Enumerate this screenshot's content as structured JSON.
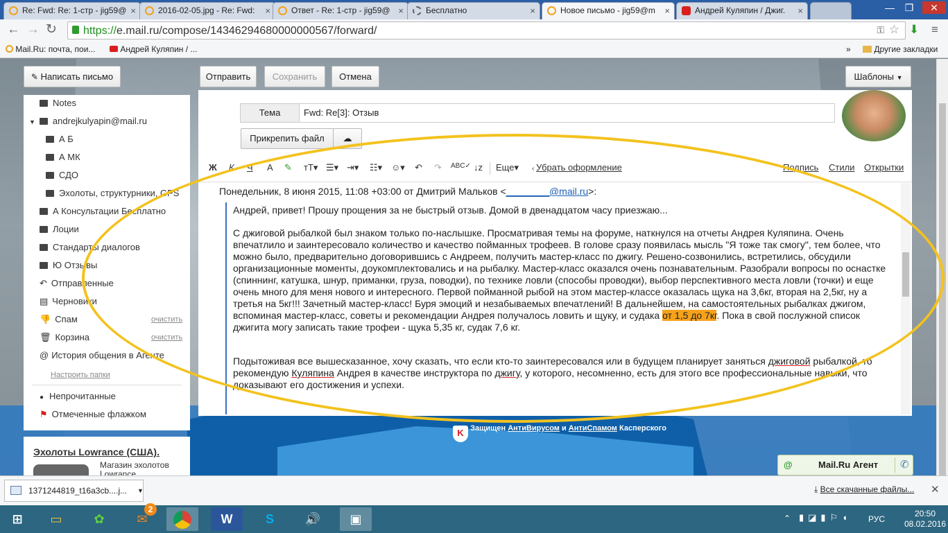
{
  "browser": {
    "tabs": [
      {
        "label": "Re: Fwd: Re: 1-стр - jig59@",
        "icon": "mailru"
      },
      {
        "label": "2016-02-05.jpg - Re: Fwd:",
        "icon": "mailru"
      },
      {
        "label": "Ответ - Re: 1-стр - jig59@",
        "icon": "mailru"
      },
      {
        "label": "Бесплатно",
        "icon": "gear"
      },
      {
        "label": "Новое письмо - jig59@m",
        "icon": "mailru",
        "active": true
      },
      {
        "label": "Андрей Куляпин / Джиг.",
        "icon": "youtube"
      }
    ],
    "url_scheme": "https://",
    "url_rest": "e.mail.ru/compose/14346294680000000567/forward/",
    "bookmarks": [
      "Mail.Ru: почта, пои...",
      "Андрей Куляпин / ..."
    ],
    "other_bookmarks": "Другие закладки"
  },
  "toolbar": {
    "compose": "Написать письмо",
    "send": "Отправить",
    "save": "Сохранить",
    "cancel": "Отмена",
    "templates": "Шаблоны"
  },
  "sidebar": {
    "folders": [
      {
        "label": "Notes",
        "indent": 1
      },
      {
        "label": "andrejkulyapin@mail.ru",
        "indent": 0,
        "expander": true
      },
      {
        "label": "А Б",
        "indent": 2
      },
      {
        "label": "А МК",
        "indent": 2
      },
      {
        "label": "СДО",
        "indent": 2
      },
      {
        "label": "Эхолоты, структурники, GPS",
        "indent": 2
      },
      {
        "label": "А Консультации Бесплатно",
        "indent": 1
      },
      {
        "label": "Лоции",
        "indent": 1
      },
      {
        "label": "Стандарты диалогов",
        "indent": 1
      },
      {
        "label": "Ю Отзывы",
        "indent": 1
      },
      {
        "label": "Отправленные",
        "indent": 1
      },
      {
        "label": "Черновики",
        "indent": 1
      },
      {
        "label": "Спам",
        "indent": 1,
        "action": "очистить"
      },
      {
        "label": "Корзина",
        "indent": 1,
        "action": "очистить"
      },
      {
        "label": "История общения в Агенте",
        "indent": 1
      }
    ],
    "configure": "Настроить папки",
    "unread": "Непрочитанные",
    "flagged": "Отмеченные флажком",
    "ad_title": "Эхолоты Lowrance (США).",
    "ad_text": "Магазин эхолотов Lowrance"
  },
  "compose": {
    "subject_label": "Тема",
    "subject_value": "Fwd: Re[3]: Отзыв",
    "attach": "Прикрепить файл",
    "format": {
      "bold": "Ж",
      "italic": "К",
      "underline": "Ч",
      "more": "Еще",
      "remove_format": "Убрать оформление",
      "signature": "Подпись",
      "styles": "Стили",
      "cards": "Открытки"
    },
    "quote_header_pre": "Понедельник, 8 июня 2015, 11:08 +03:00 от Дмитрий Мальков <",
    "quote_header_link": "________@mail.ru",
    "quote_header_post": ">:",
    "p1": "Андрей, привет! Прошу прощения за не быстрый отзыв. Домой в двенадцатом часу приезжаю...",
    "p2_a": "С джиговой рыбалкой был знаком только по-наслышке. Просматривая темы на форуме, наткнулся на отчеты Андрея Куляпина. Очень впечатлило и заинтересовало количество и качество пойманных трофеев. В голове сразу появилась мысль \"Я тоже так смогу\", тем более, что можно было, предварительно договорившись с Андреем, получить мастер-класс по джигу. Решено-созвонились, встретились, обсудили организационные моменты, доукомплектовались и на рыбалку. Мастер-класс оказался очень познавательным. Разобрали вопросы по оснастке (спиннинг, катушка, шнур, приманки, груза, поводки), по технике ловли (способы проводки), выбор перспективного места ловли (точки) и еще очень много для меня нового и интересного. Первой пойманной рыбой на этом мастер-классе оказалась щука на 3,6кг, вторая на 2,5кг, ну а третья на 5кг!!! Зачетный мастер-класс! Буря эмоций и незабываемых впечатлений! В дальнейшем, на самостоятельных рыбалках джигом, вспоминая мастер-класс, советы и рекомендации Андрея получалось ловить и щуку, и судака ",
    "p2_hl": "от 1,5 до 7кг",
    "p2_b": ". Пока в свой послужной список джигита могу записать такие трофеи - щука 5,35 кг, судак 7,6 кг.",
    "p3_a": "Подытоживая все вышесказанное, хочу сказать, что если кто-то заинтересовался или в будущем планирует заняться ",
    "p3_u1": "джиговой",
    "p3_b": " рыбалкой, то рекомендую ",
    "p3_u2": "Куляпина",
    "p3_c": " Андрея в качестве инструктора по ",
    "p3_u3": "джигу",
    "p3_d": ", у которого, несомненно, есть для этого все профессиональные навыки, что доказывают его достижения и успехи."
  },
  "footer": {
    "kaspersky_pre": "Защищен ",
    "kaspersky_av": "АнтиВирусом",
    "kaspersky_and": " и ",
    "kaspersky_as": "АнтиСпамом",
    "kaspersky_post": " Касперского",
    "agent": "Mail.Ru Агент"
  },
  "downloads": {
    "file": "1371244819_t16a3cb....j...",
    "all": "Все скачанные файлы..."
  },
  "taskbar": {
    "lang": "РУС",
    "time": "20:50",
    "date": "08.02.2016",
    "badge": "2"
  },
  "colors": {
    "highlight": "#f7a21b",
    "ellipse": "#f3c21e",
    "taskbar": "#2d6680"
  }
}
